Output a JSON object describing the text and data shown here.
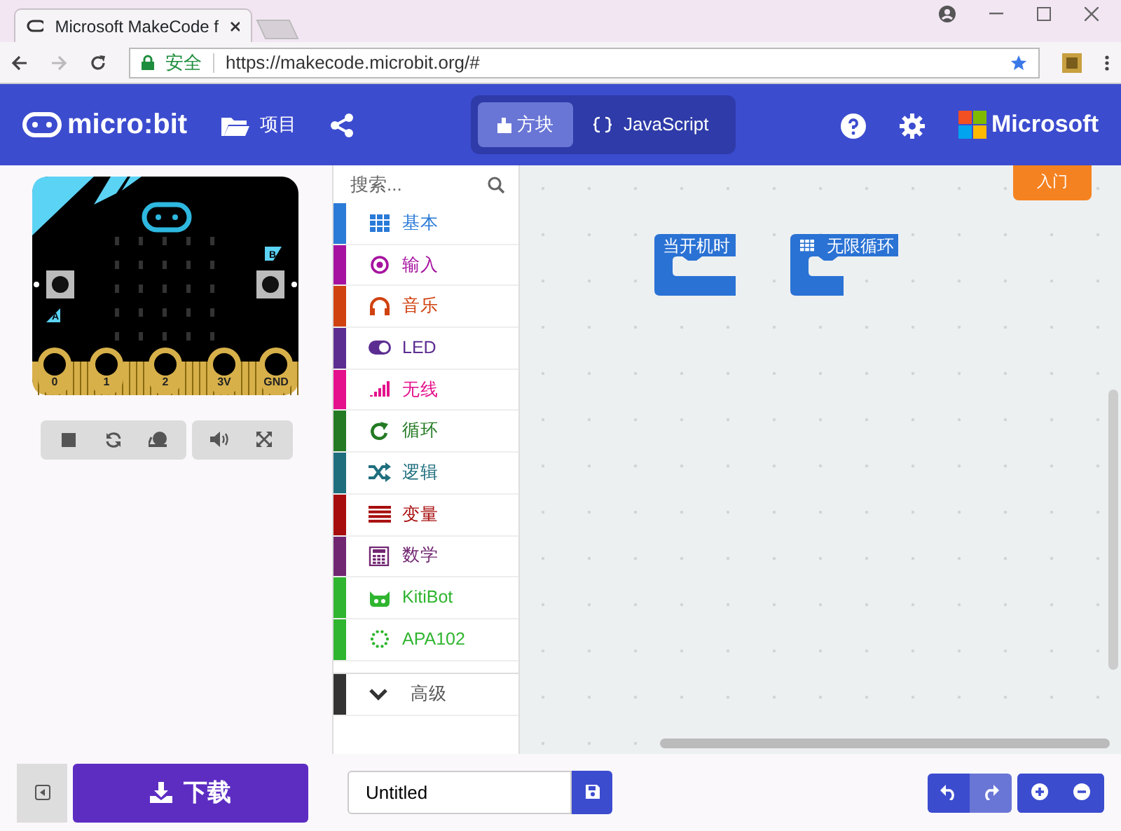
{
  "browser": {
    "tab_title": "Microsoft MakeCode f",
    "security_label": "安全",
    "url": "https://makecode.microbit.org/#"
  },
  "header": {
    "logo": "micro:bit",
    "projects": "项目",
    "editor_tabs": [
      {
        "label": "方块",
        "selected": true
      },
      {
        "label": "JavaScript",
        "selected": false
      }
    ],
    "brand": "Microsoft"
  },
  "simulator": {
    "buttons": [
      "A",
      "B"
    ],
    "pins": [
      "0",
      "1",
      "2",
      "3V",
      "GND"
    ]
  },
  "toolbox": {
    "search": {
      "placeholder": "搜索..."
    },
    "categories": [
      {
        "label": "基本",
        "color": "#2a7ad8",
        "kind": "grid"
      },
      {
        "label": "输入",
        "color": "#a6129f",
        "kind": "target"
      },
      {
        "label": "音乐",
        "color": "#d04210",
        "kind": "headphones"
      },
      {
        "label": "LED",
        "color": "#5c2d91",
        "kind": "toggle"
      },
      {
        "label": "无线",
        "color": "#e4108c",
        "kind": "signal"
      },
      {
        "label": "循环",
        "color": "#237a23",
        "kind": "loop"
      },
      {
        "label": "逻辑",
        "color": "#1f6e7e",
        "kind": "shuffle"
      },
      {
        "label": "变量",
        "color": "#a80d0d",
        "kind": "lines"
      },
      {
        "label": "数学",
        "color": "#712672",
        "kind": "calculator"
      },
      {
        "label": "KitiBot",
        "color": "#2fb52f",
        "kind": "cat"
      },
      {
        "label": "APA102",
        "color": "#2fb52f",
        "kind": "dots"
      }
    ],
    "advanced": "高级"
  },
  "workspace": {
    "getting_started": "入门",
    "blocks": [
      {
        "label": "当开机时",
        "kind": "event"
      },
      {
        "label": "无限循环",
        "kind": "loop"
      }
    ]
  },
  "bottom_bar": {
    "download": "下载",
    "project_name": "Untitled",
    "undo": {
      "disabled": false
    },
    "redo": {
      "disabled": true
    }
  }
}
